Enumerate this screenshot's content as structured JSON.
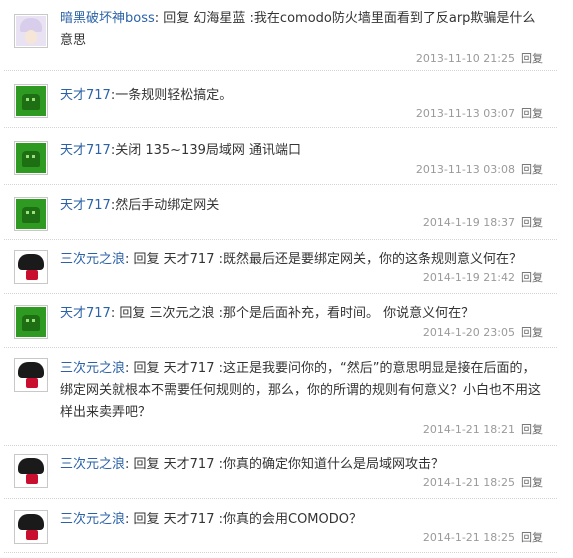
{
  "comments": [
    {
      "user": "暗黑破坏神boss",
      "sep": ": ",
      "text": "回复 幻海星蓝 :我在comodo防火墙里面看到了反arp欺骗是什么意思",
      "time": "2013-11-10 21:25",
      "reply": "回复",
      "avatar": "anime-avatar"
    },
    {
      "user": "天才717",
      "sep": ":",
      "text": "一条规则轻松搞定。",
      "time": "2013-11-13 03:07",
      "reply": "回复",
      "avatar": "green-avatar"
    },
    {
      "user": "天才717",
      "sep": ":",
      "text": "关闭 135~139局域网 通讯端口",
      "time": "2013-11-13 03:08",
      "reply": "回复",
      "avatar": "green-avatar"
    },
    {
      "user": "天才717",
      "sep": ":",
      "text": "然后手动绑定网关",
      "time": "2014-1-19 18:37",
      "reply": "回复",
      "avatar": "green-avatar"
    },
    {
      "user": "三次元之浪",
      "sep": ": ",
      "text": "回复 天才717 :既然最后还是要绑定网关，你的这条规则意义何在？",
      "time": "2014-1-19 21:42",
      "reply": "回复",
      "avatar": "red-avatar"
    },
    {
      "user": "天才717",
      "sep": ": ",
      "text": "回复 三次元之浪 :那个是后面补充，看时间。 你说意义何在？",
      "time": "2014-1-20 23:05",
      "reply": "回复",
      "avatar": "green-avatar"
    },
    {
      "user": "三次元之浪",
      "sep": ": ",
      "text": "回复 天才717 :这正是我要问你的，“然后”的意思明显是接在后面的，绑定网关就根本不需要任何规则的，那么，你的所谓的规则有何意义？小白也不用这样出来卖弄吧？",
      "time": "2014-1-21 18:21",
      "reply": "回复",
      "avatar": "red-avatar"
    },
    {
      "user": "三次元之浪",
      "sep": ": ",
      "text": "回复 天才717 :你真的确定你知道什么是局域网攻击？",
      "time": "2014-1-21 18:25",
      "reply": "回复",
      "avatar": "red-avatar"
    },
    {
      "user": "三次元之浪",
      "sep": ": ",
      "text": "回复 天才717 :你真的会用COMODO？",
      "time": "2014-1-21 18:25",
      "reply": "回复",
      "avatar": "red-avatar"
    }
  ]
}
